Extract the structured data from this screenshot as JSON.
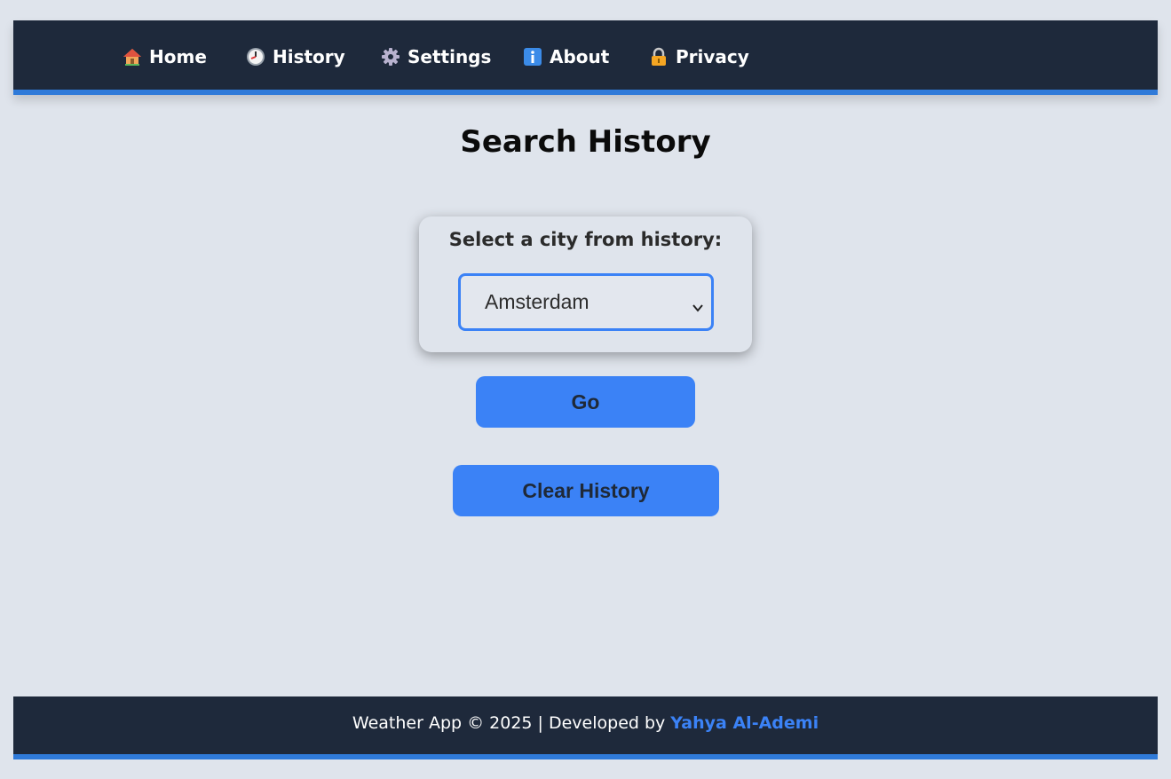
{
  "nav": {
    "items": [
      {
        "label": "Home",
        "icon": "house-icon"
      },
      {
        "label": "History",
        "icon": "clock-icon"
      },
      {
        "label": "Settings",
        "icon": "gear-icon"
      },
      {
        "label": "About",
        "icon": "info-icon"
      },
      {
        "label": "Privacy",
        "icon": "lock-icon"
      }
    ]
  },
  "page": {
    "title": "Search History"
  },
  "history_card": {
    "label": "Select a city from history:",
    "selected_city": "Amsterdam"
  },
  "buttons": {
    "go_label": "Go",
    "clear_label": "Clear History"
  },
  "footer": {
    "text": "Weather App © 2025 | Developed by",
    "author": "Yahya Al-Ademi"
  },
  "colors": {
    "navbar_bg": "#1e293b",
    "accent": "#3b82f6",
    "page_bg": "#dfe4ec"
  }
}
